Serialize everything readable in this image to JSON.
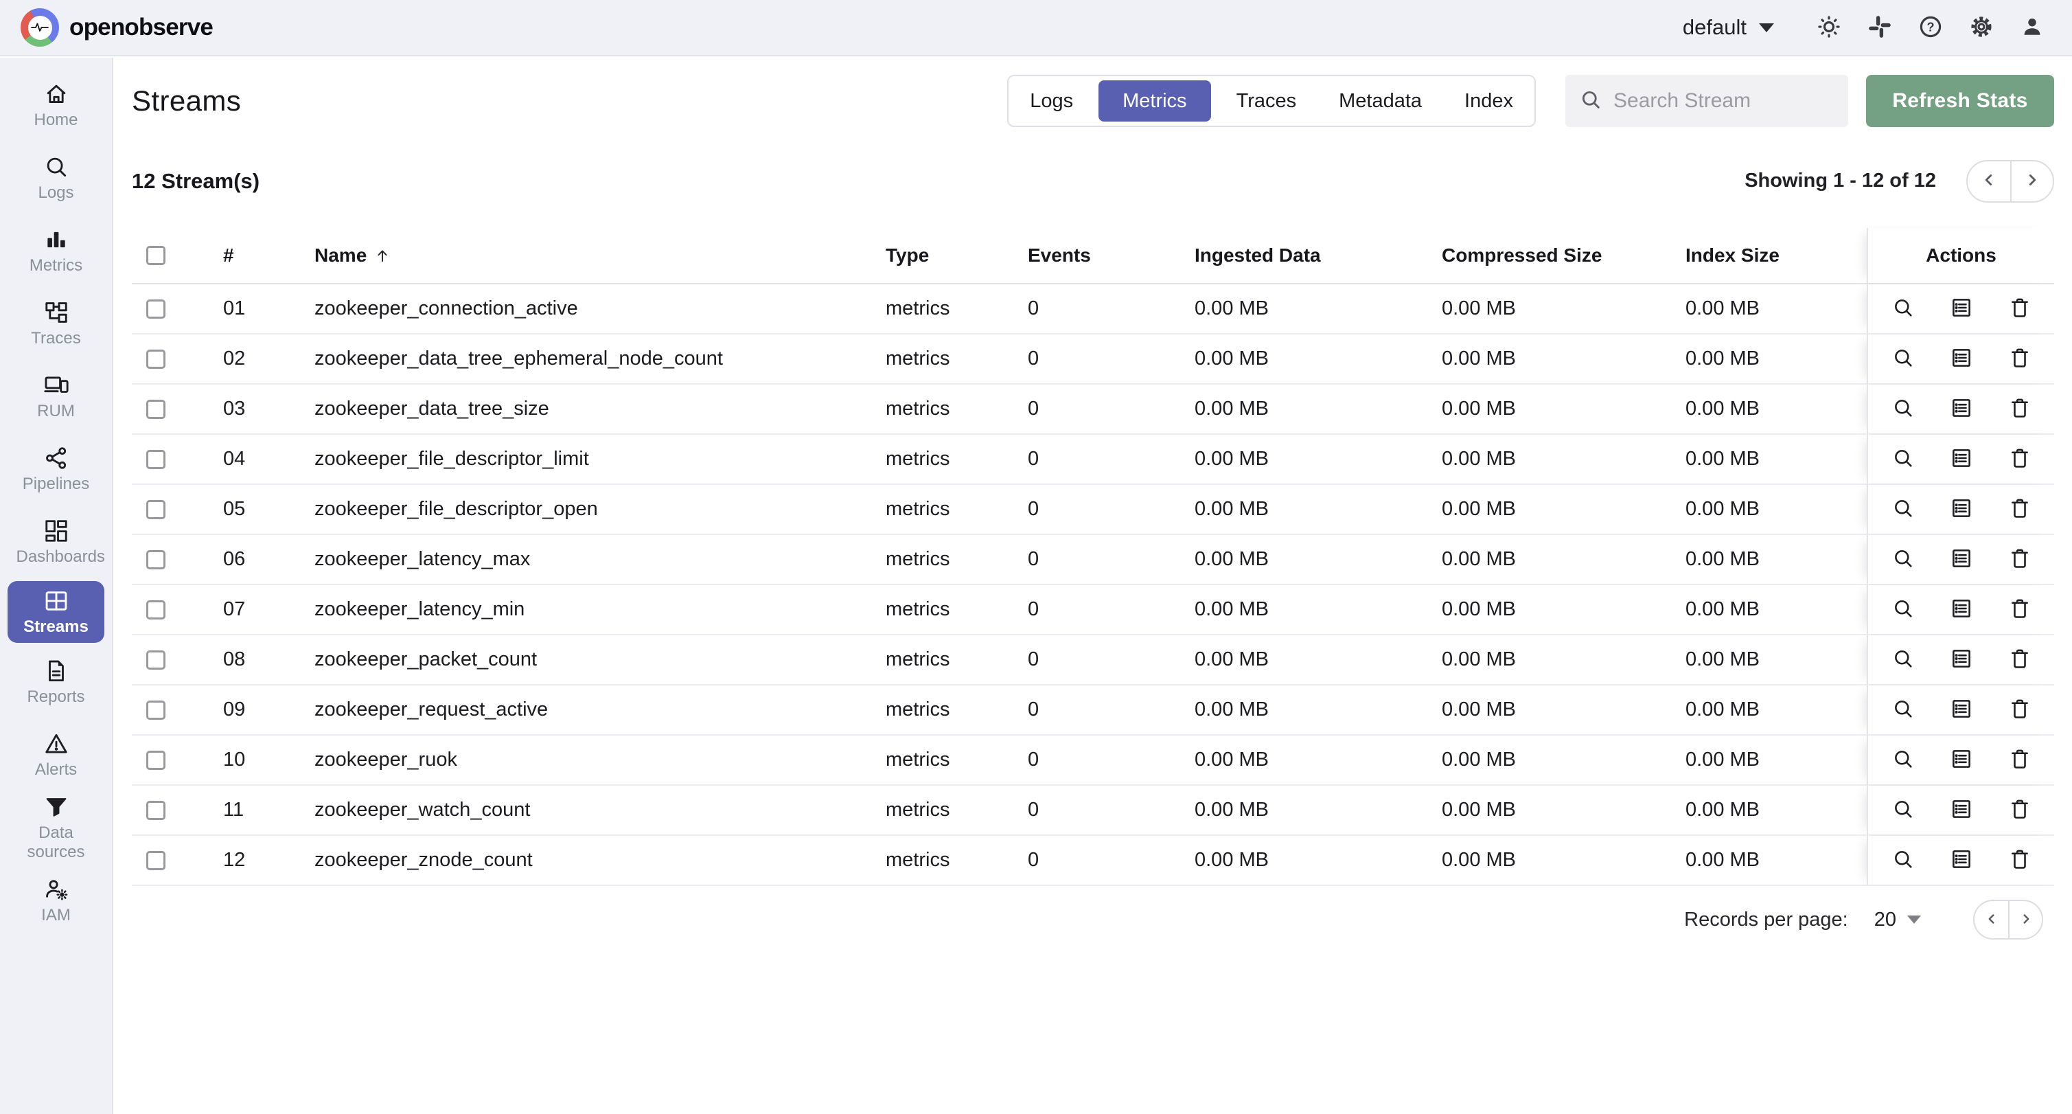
{
  "topbar": {
    "brand": "openobserve",
    "org": "default",
    "icons": [
      "light-mode",
      "slack",
      "help",
      "settings",
      "profile"
    ]
  },
  "sidebar": {
    "items": [
      {
        "label": "Home",
        "icon": "home"
      },
      {
        "label": "Logs",
        "icon": "search"
      },
      {
        "label": "Metrics",
        "icon": "metrics"
      },
      {
        "label": "Traces",
        "icon": "traces"
      },
      {
        "label": "RUM",
        "icon": "rum"
      },
      {
        "label": "Pipelines",
        "icon": "pipelines"
      },
      {
        "label": "Dashboards",
        "icon": "dashboards"
      },
      {
        "label": "Streams",
        "icon": "streams",
        "active": true
      },
      {
        "label": "Reports",
        "icon": "reports"
      },
      {
        "label": "Alerts",
        "icon": "alerts"
      },
      {
        "label": "Data sources",
        "icon": "datasources"
      },
      {
        "label": "IAM",
        "icon": "iam"
      }
    ]
  },
  "header": {
    "title": "Streams",
    "tabs": [
      {
        "label": "Logs"
      },
      {
        "label": "Metrics",
        "active": true
      },
      {
        "label": "Traces"
      },
      {
        "label": "Metadata"
      },
      {
        "label": "Index"
      }
    ],
    "search_placeholder": "Search Stream",
    "refresh_button": "Refresh Stats"
  },
  "summary": {
    "count": "12 Stream(s)",
    "showing": "Showing 1 - 12 of 12"
  },
  "table": {
    "columns": [
      "#",
      "Name",
      "Type",
      "Events",
      "Ingested Data",
      "Compressed Size",
      "Index Size",
      "Actions"
    ],
    "sorted_column": "Name",
    "sort_direction": "ascending",
    "row_actions": [
      "explore",
      "details",
      "delete"
    ],
    "rows": [
      {
        "num": "01",
        "name": "zookeeper_connection_active",
        "type": "metrics",
        "events": "0",
        "ingested": "0.00 MB",
        "compressed": "0.00 MB",
        "index_size": "0.00 MB"
      },
      {
        "num": "02",
        "name": "zookeeper_data_tree_ephemeral_node_count",
        "type": "metrics",
        "events": "0",
        "ingested": "0.00 MB",
        "compressed": "0.00 MB",
        "index_size": "0.00 MB"
      },
      {
        "num": "03",
        "name": "zookeeper_data_tree_size",
        "type": "metrics",
        "events": "0",
        "ingested": "0.00 MB",
        "compressed": "0.00 MB",
        "index_size": "0.00 MB"
      },
      {
        "num": "04",
        "name": "zookeeper_file_descriptor_limit",
        "type": "metrics",
        "events": "0",
        "ingested": "0.00 MB",
        "compressed": "0.00 MB",
        "index_size": "0.00 MB"
      },
      {
        "num": "05",
        "name": "zookeeper_file_descriptor_open",
        "type": "metrics",
        "events": "0",
        "ingested": "0.00 MB",
        "compressed": "0.00 MB",
        "index_size": "0.00 MB"
      },
      {
        "num": "06",
        "name": "zookeeper_latency_max",
        "type": "metrics",
        "events": "0",
        "ingested": "0.00 MB",
        "compressed": "0.00 MB",
        "index_size": "0.00 MB"
      },
      {
        "num": "07",
        "name": "zookeeper_latency_min",
        "type": "metrics",
        "events": "0",
        "ingested": "0.00 MB",
        "compressed": "0.00 MB",
        "index_size": "0.00 MB"
      },
      {
        "num": "08",
        "name": "zookeeper_packet_count",
        "type": "metrics",
        "events": "0",
        "ingested": "0.00 MB",
        "compressed": "0.00 MB",
        "index_size": "0.00 MB"
      },
      {
        "num": "09",
        "name": "zookeeper_request_active",
        "type": "metrics",
        "events": "0",
        "ingested": "0.00 MB",
        "compressed": "0.00 MB",
        "index_size": "0.00 MB"
      },
      {
        "num": "10",
        "name": "zookeeper_ruok",
        "type": "metrics",
        "events": "0",
        "ingested": "0.00 MB",
        "compressed": "0.00 MB",
        "index_size": "0.00 MB"
      },
      {
        "num": "11",
        "name": "zookeeper_watch_count",
        "type": "metrics",
        "events": "0",
        "ingested": "0.00 MB",
        "compressed": "0.00 MB",
        "index_size": "0.00 MB"
      },
      {
        "num": "12",
        "name": "zookeeper_znode_count",
        "type": "metrics",
        "events": "0",
        "ingested": "0.00 MB",
        "compressed": "0.00 MB",
        "index_size": "0.00 MB"
      }
    ]
  },
  "footer": {
    "records_label": "Records per page:",
    "records_value": "20"
  },
  "colors": {
    "accent": "#5960b2",
    "refresh_green": "#74a084",
    "topbar_bg": "#f0f1f6",
    "divider": "#e3e4ea"
  }
}
